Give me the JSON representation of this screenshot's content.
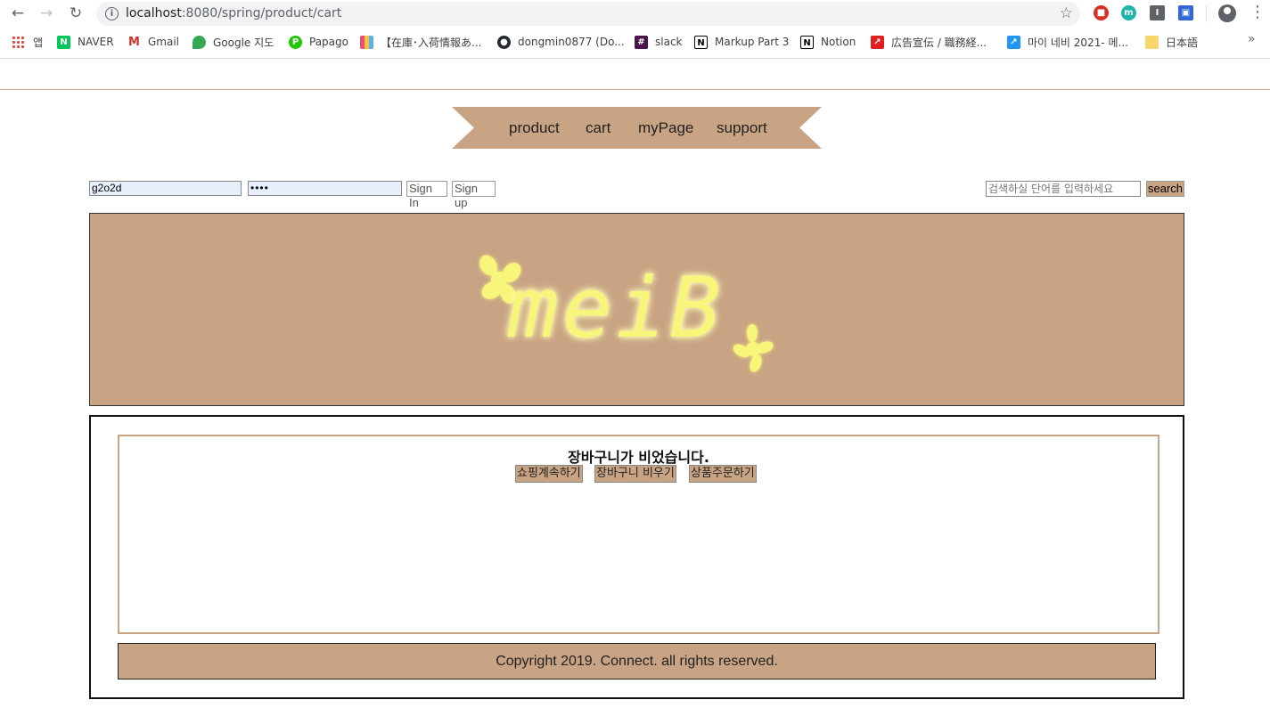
{
  "browser": {
    "url_host": "localhost",
    "url_rest": ":8080/spring/product/cart",
    "bookmarks": [
      "앱",
      "NAVER",
      "Gmail",
      "Google 지도",
      "Papago",
      "【在庫･入荷情報あ...",
      "dongmin0877 (Do...",
      "slack",
      "Markup Part 3",
      "Notion",
      "広告宣伝 / 職務経...",
      "마이 네비 2021- 메...",
      "日本語"
    ],
    "more": "»"
  },
  "nav": {
    "items": [
      "product",
      "cart",
      "myPage",
      "support"
    ]
  },
  "login": {
    "username_value": "g2o2d",
    "password_value": "••••",
    "sign_in_label": "Sign In",
    "sign_up_label": "Sign up"
  },
  "search": {
    "placeholder": "검색하실 단어를 입력하세요",
    "button_label": "search"
  },
  "banner": {
    "logo_text": "meiB"
  },
  "cart": {
    "empty_message": "장바구니가 비었습니다.",
    "continue_label": "쇼핑계속하기",
    "clear_label": "장바구니 비우기",
    "order_label": "상품주문하기"
  },
  "footer": {
    "text": "Copyright 2019. Connect. all rights reserved."
  },
  "colors": {
    "accent": "#c8a384",
    "logo": "#f7f57a"
  }
}
